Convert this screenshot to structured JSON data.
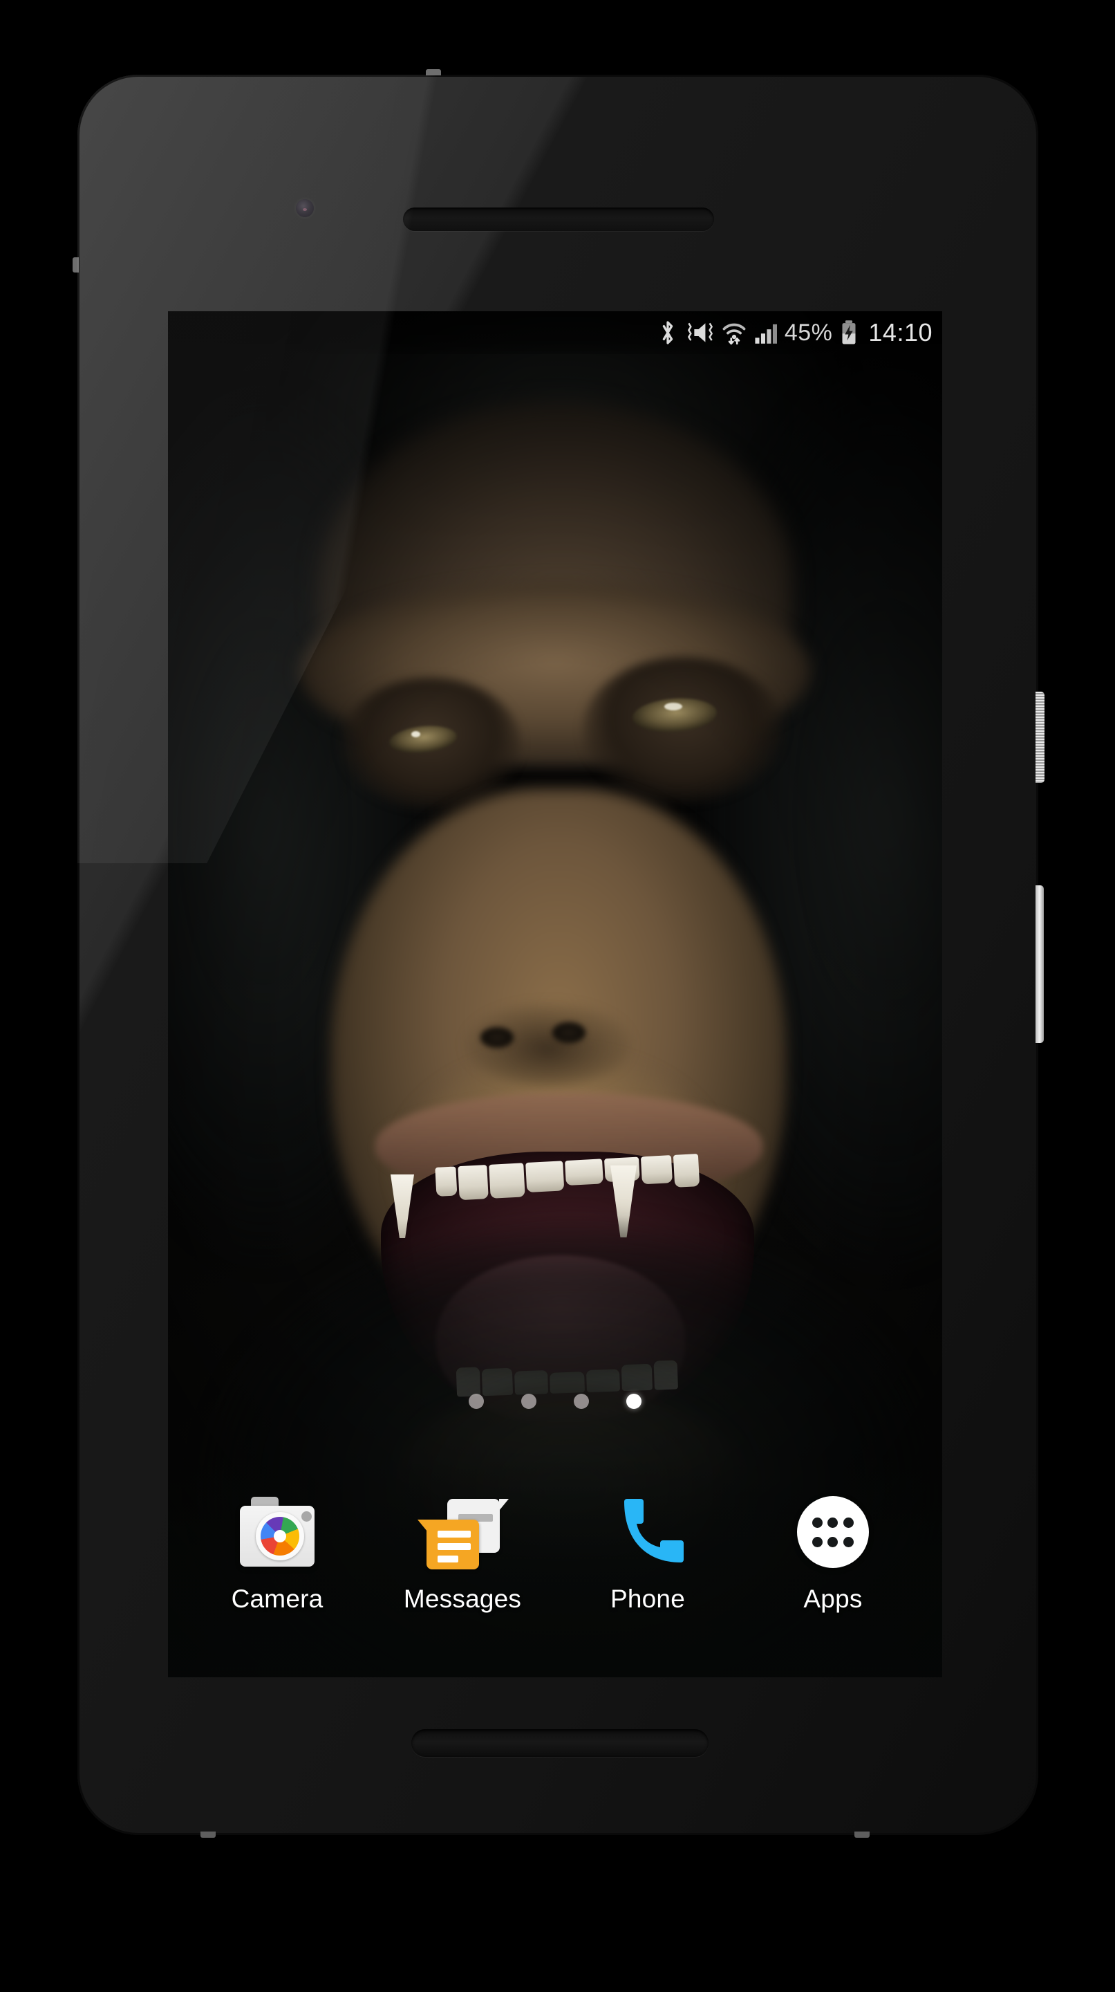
{
  "device": {
    "type": "android-smartphone-mockup",
    "body_color": "#1a1a1a",
    "rim_color": "#d8d8d8",
    "hardware": {
      "front_camera": "front-camera",
      "earpiece_speaker": "earpiece-speaker",
      "bottom_speaker": "bottom-speaker",
      "power_button": "power-button",
      "volume_button": "volume-rocker"
    }
  },
  "status_bar": {
    "icons": [
      {
        "name": "bluetooth-icon",
        "label": "Bluetooth"
      },
      {
        "name": "volume-mute-vibrate-icon",
        "label": "Silent / Vibrate"
      },
      {
        "name": "wifi-icon",
        "label": "Wi-Fi with data activity"
      },
      {
        "name": "cellular-signal-icon",
        "label": "Cellular signal"
      }
    ],
    "battery_percent": "45%",
    "battery_state": "charging",
    "battery_icon": "battery-charging-icon",
    "clock": "14:10",
    "text_color": "#e0e0e0"
  },
  "wallpaper": {
    "name": "chimpanzee-face-wallpaper",
    "description": "Dark close-up of a screaming chimpanzee face",
    "dominant_colors": [
      "#0a0b0b",
      "#5a4833",
      "#8a6d49",
      "#5a2c33"
    ]
  },
  "page_indicator": {
    "total_pages": 4,
    "active_page": 4,
    "dots": [
      {
        "active": false
      },
      {
        "active": false
      },
      {
        "active": false
      },
      {
        "active": true
      }
    ],
    "inactive_color": "#b6b0af",
    "active_color": "#ffffff"
  },
  "dock": {
    "items": [
      {
        "label": "Camera",
        "icon": "camera-icon",
        "accent": "#ea4335"
      },
      {
        "label": "Messages",
        "icon": "messages-icon",
        "accent": "#f5a623"
      },
      {
        "label": "Phone",
        "icon": "phone-icon",
        "accent": "#29b6f6"
      },
      {
        "label": "Apps",
        "icon": "apps-drawer-icon",
        "accent": "#ffffff"
      }
    ],
    "label_color": "#ffffff"
  }
}
